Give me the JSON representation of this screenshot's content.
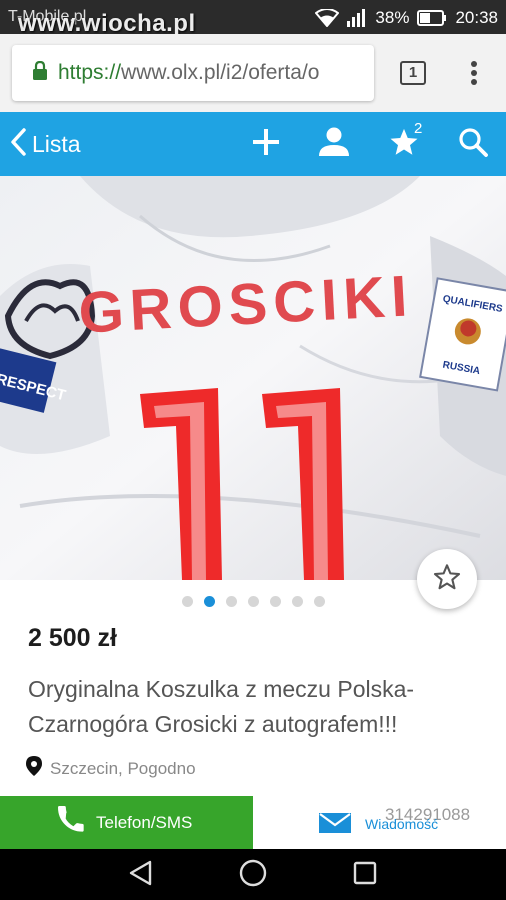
{
  "status_bar": {
    "carrier": "T-Mobile.pl",
    "watermark": "www.wiocha.pl",
    "battery_percent": "38%",
    "time": "20:38"
  },
  "browser": {
    "url_scheme": "https://",
    "url_rest": "www.olx.pl/i2/oferta/o",
    "tab_count": "1"
  },
  "app_bar": {
    "back_label": "Lista",
    "favorites_count": "2",
    "color": "#1fa3e3"
  },
  "photo": {
    "shirt_name": "GROSCIKI",
    "shirt_number": "11",
    "patch_line1": "QUALIFIERS",
    "patch_line2": "RUSSIA",
    "sleeve_text": "RESPECT",
    "carousel_total": 7,
    "carousel_active_index": 1
  },
  "listing": {
    "price": "2 500 zł",
    "title": "Oryginalna Koszulka z meczu Polska-Czarnogóra Grosicki z autografem!!!",
    "location": "Szczecin, Pogodno"
  },
  "actions": {
    "phone_label": "Telefon/SMS",
    "message_label": "Wiadomość",
    "phone_number": "314291088",
    "phone_color": "#37a52b",
    "accent": "#1a8fd8"
  },
  "icons": [
    "wifi-icon",
    "signal-icon",
    "battery-icon",
    "lock-icon",
    "chevron-left-icon",
    "plus-icon",
    "user-icon",
    "star-icon",
    "search-icon",
    "star-outline-icon",
    "phone-icon",
    "envelope-icon",
    "location-pin-icon",
    "nav-back-icon",
    "nav-home-icon",
    "nav-recent-icon"
  ]
}
